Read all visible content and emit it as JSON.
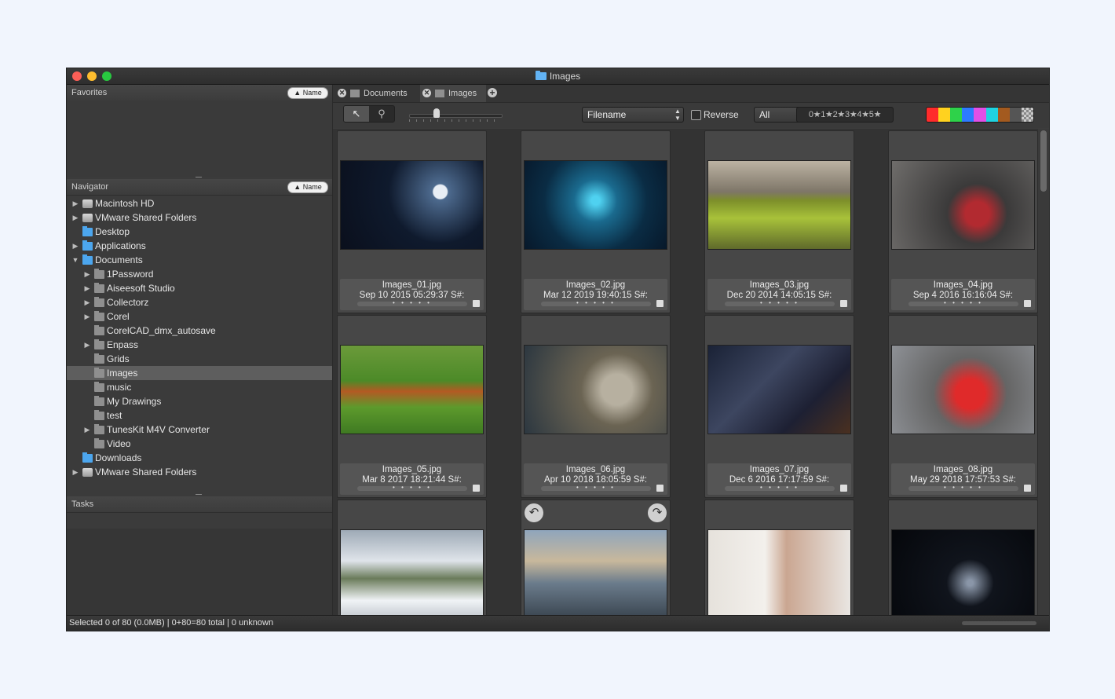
{
  "window": {
    "title": "Images"
  },
  "sidebar": {
    "favorites_title": "Favorites",
    "navigator_title": "Navigator",
    "tasks_title": "Tasks",
    "sort_button": "▲ Name",
    "tree": [
      {
        "label": "Macintosh HD",
        "depth": 0,
        "toggle": "▶",
        "icon": "disk"
      },
      {
        "label": "VMware Shared Folders",
        "depth": 0,
        "toggle": "▶",
        "icon": "disk"
      },
      {
        "label": "Desktop",
        "depth": 0,
        "toggle": "",
        "icon": "blue"
      },
      {
        "label": "Applications",
        "depth": 0,
        "toggle": "▶",
        "icon": "blue"
      },
      {
        "label": "Documents",
        "depth": 0,
        "toggle": "▼",
        "icon": "blue"
      },
      {
        "label": "1Password",
        "depth": 1,
        "toggle": "▶",
        "icon": "gray"
      },
      {
        "label": "Aiseesoft Studio",
        "depth": 1,
        "toggle": "▶",
        "icon": "gray"
      },
      {
        "label": "Collectorz",
        "depth": 1,
        "toggle": "▶",
        "icon": "gray"
      },
      {
        "label": "Corel",
        "depth": 1,
        "toggle": "▶",
        "icon": "gray"
      },
      {
        "label": "CorelCAD_dmx_autosave",
        "depth": 1,
        "toggle": "",
        "icon": "gray"
      },
      {
        "label": "Enpass",
        "depth": 1,
        "toggle": "▶",
        "icon": "gray"
      },
      {
        "label": "Grids",
        "depth": 1,
        "toggle": "",
        "icon": "gray"
      },
      {
        "label": "Images",
        "depth": 1,
        "toggle": "",
        "icon": "gray",
        "selected": true
      },
      {
        "label": "music",
        "depth": 1,
        "toggle": "",
        "icon": "gray"
      },
      {
        "label": "My Drawings",
        "depth": 1,
        "toggle": "",
        "icon": "gray"
      },
      {
        "label": "test",
        "depth": 1,
        "toggle": "",
        "icon": "gray"
      },
      {
        "label": "TunesKit M4V Converter",
        "depth": 1,
        "toggle": "▶",
        "icon": "gray"
      },
      {
        "label": "Video",
        "depth": 1,
        "toggle": "",
        "icon": "gray"
      },
      {
        "label": "Downloads",
        "depth": 0,
        "toggle": "",
        "icon": "blue"
      },
      {
        "label": "VMware Shared Folders",
        "depth": 0,
        "toggle": "▶",
        "icon": "disk"
      }
    ]
  },
  "tabs": [
    {
      "label": "Documents",
      "close": "✕"
    },
    {
      "label": "Images",
      "close": "✕"
    }
  ],
  "tab_add": "+",
  "toolbar": {
    "select_tool": "↖",
    "zoom_tool": "⚲",
    "thumb_size_fraction": 0.3,
    "sort_by": "Filename",
    "reverse_label": "Reverse",
    "filter": "All",
    "check_mark": "✓",
    "caret": "▲▼",
    "rating_filter": "0★1★2★3★4★5★",
    "color_labels": [
      "#ff2b2b",
      "#ffd21f",
      "#2ed24a",
      "#2d7bff",
      "#e24fe6",
      "#1fd3e0",
      "#a35a1f",
      "#555555"
    ]
  },
  "grid": {
    "rating_dots": "• • • • •",
    "rotate_left": "↶",
    "rotate_right": "↷",
    "items": [
      {
        "name": "Images_01.jpg",
        "date": "Sep 10 2015 05:29:37 S#:"
      },
      {
        "name": "Images_02.jpg",
        "date": "Mar 12 2019 19:40:15 S#:"
      },
      {
        "name": "Images_03.jpg",
        "date": "Dec 20 2014 14:05:15 S#:"
      },
      {
        "name": "Images_04.jpg",
        "date": "Sep 4 2016 16:16:04 S#:"
      },
      {
        "name": "Images_05.jpg",
        "date": "Mar 8 2017 18:21:44 S#:"
      },
      {
        "name": "Images_06.jpg",
        "date": "Apr 10 2018 18:05:59 S#:"
      },
      {
        "name": "Images_07.jpg",
        "date": "Dec 6 2016 17:17:59 S#:"
      },
      {
        "name": "Images_08.jpg",
        "date": "May 29 2018 17:57:53 S#:"
      },
      {
        "name": "",
        "date": ""
      },
      {
        "name": "",
        "date": ""
      },
      {
        "name": "",
        "date": ""
      },
      {
        "name": "",
        "date": ""
      }
    ]
  },
  "status": {
    "text": "Selected 0 of 80 (0.0MB) | 0+80=80 total | 0 unknown"
  }
}
